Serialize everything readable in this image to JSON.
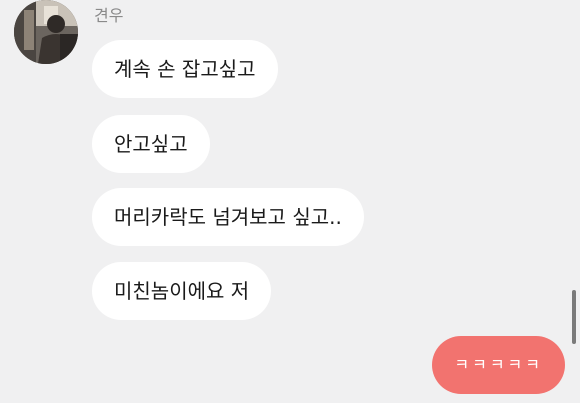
{
  "conversation": {
    "sender": {
      "name": "견우"
    },
    "received_messages": [
      {
        "text": "계속 손 잡고싶고"
      },
      {
        "text": "안고싶고"
      },
      {
        "text": "머리카락도 넘겨보고 싶고.."
      },
      {
        "text": "미친놈이에요 저"
      }
    ],
    "sent_messages": [
      {
        "text": "ㅋㅋㅋㅋㅋ"
      }
    ]
  },
  "colors": {
    "background": "#f0f0f1",
    "received_bubble": "#ffffff",
    "sent_bubble": "#f2736f",
    "sender_name": "#8a8a8a"
  },
  "icons": {
    "avatar": "profile-photo-avatar"
  }
}
